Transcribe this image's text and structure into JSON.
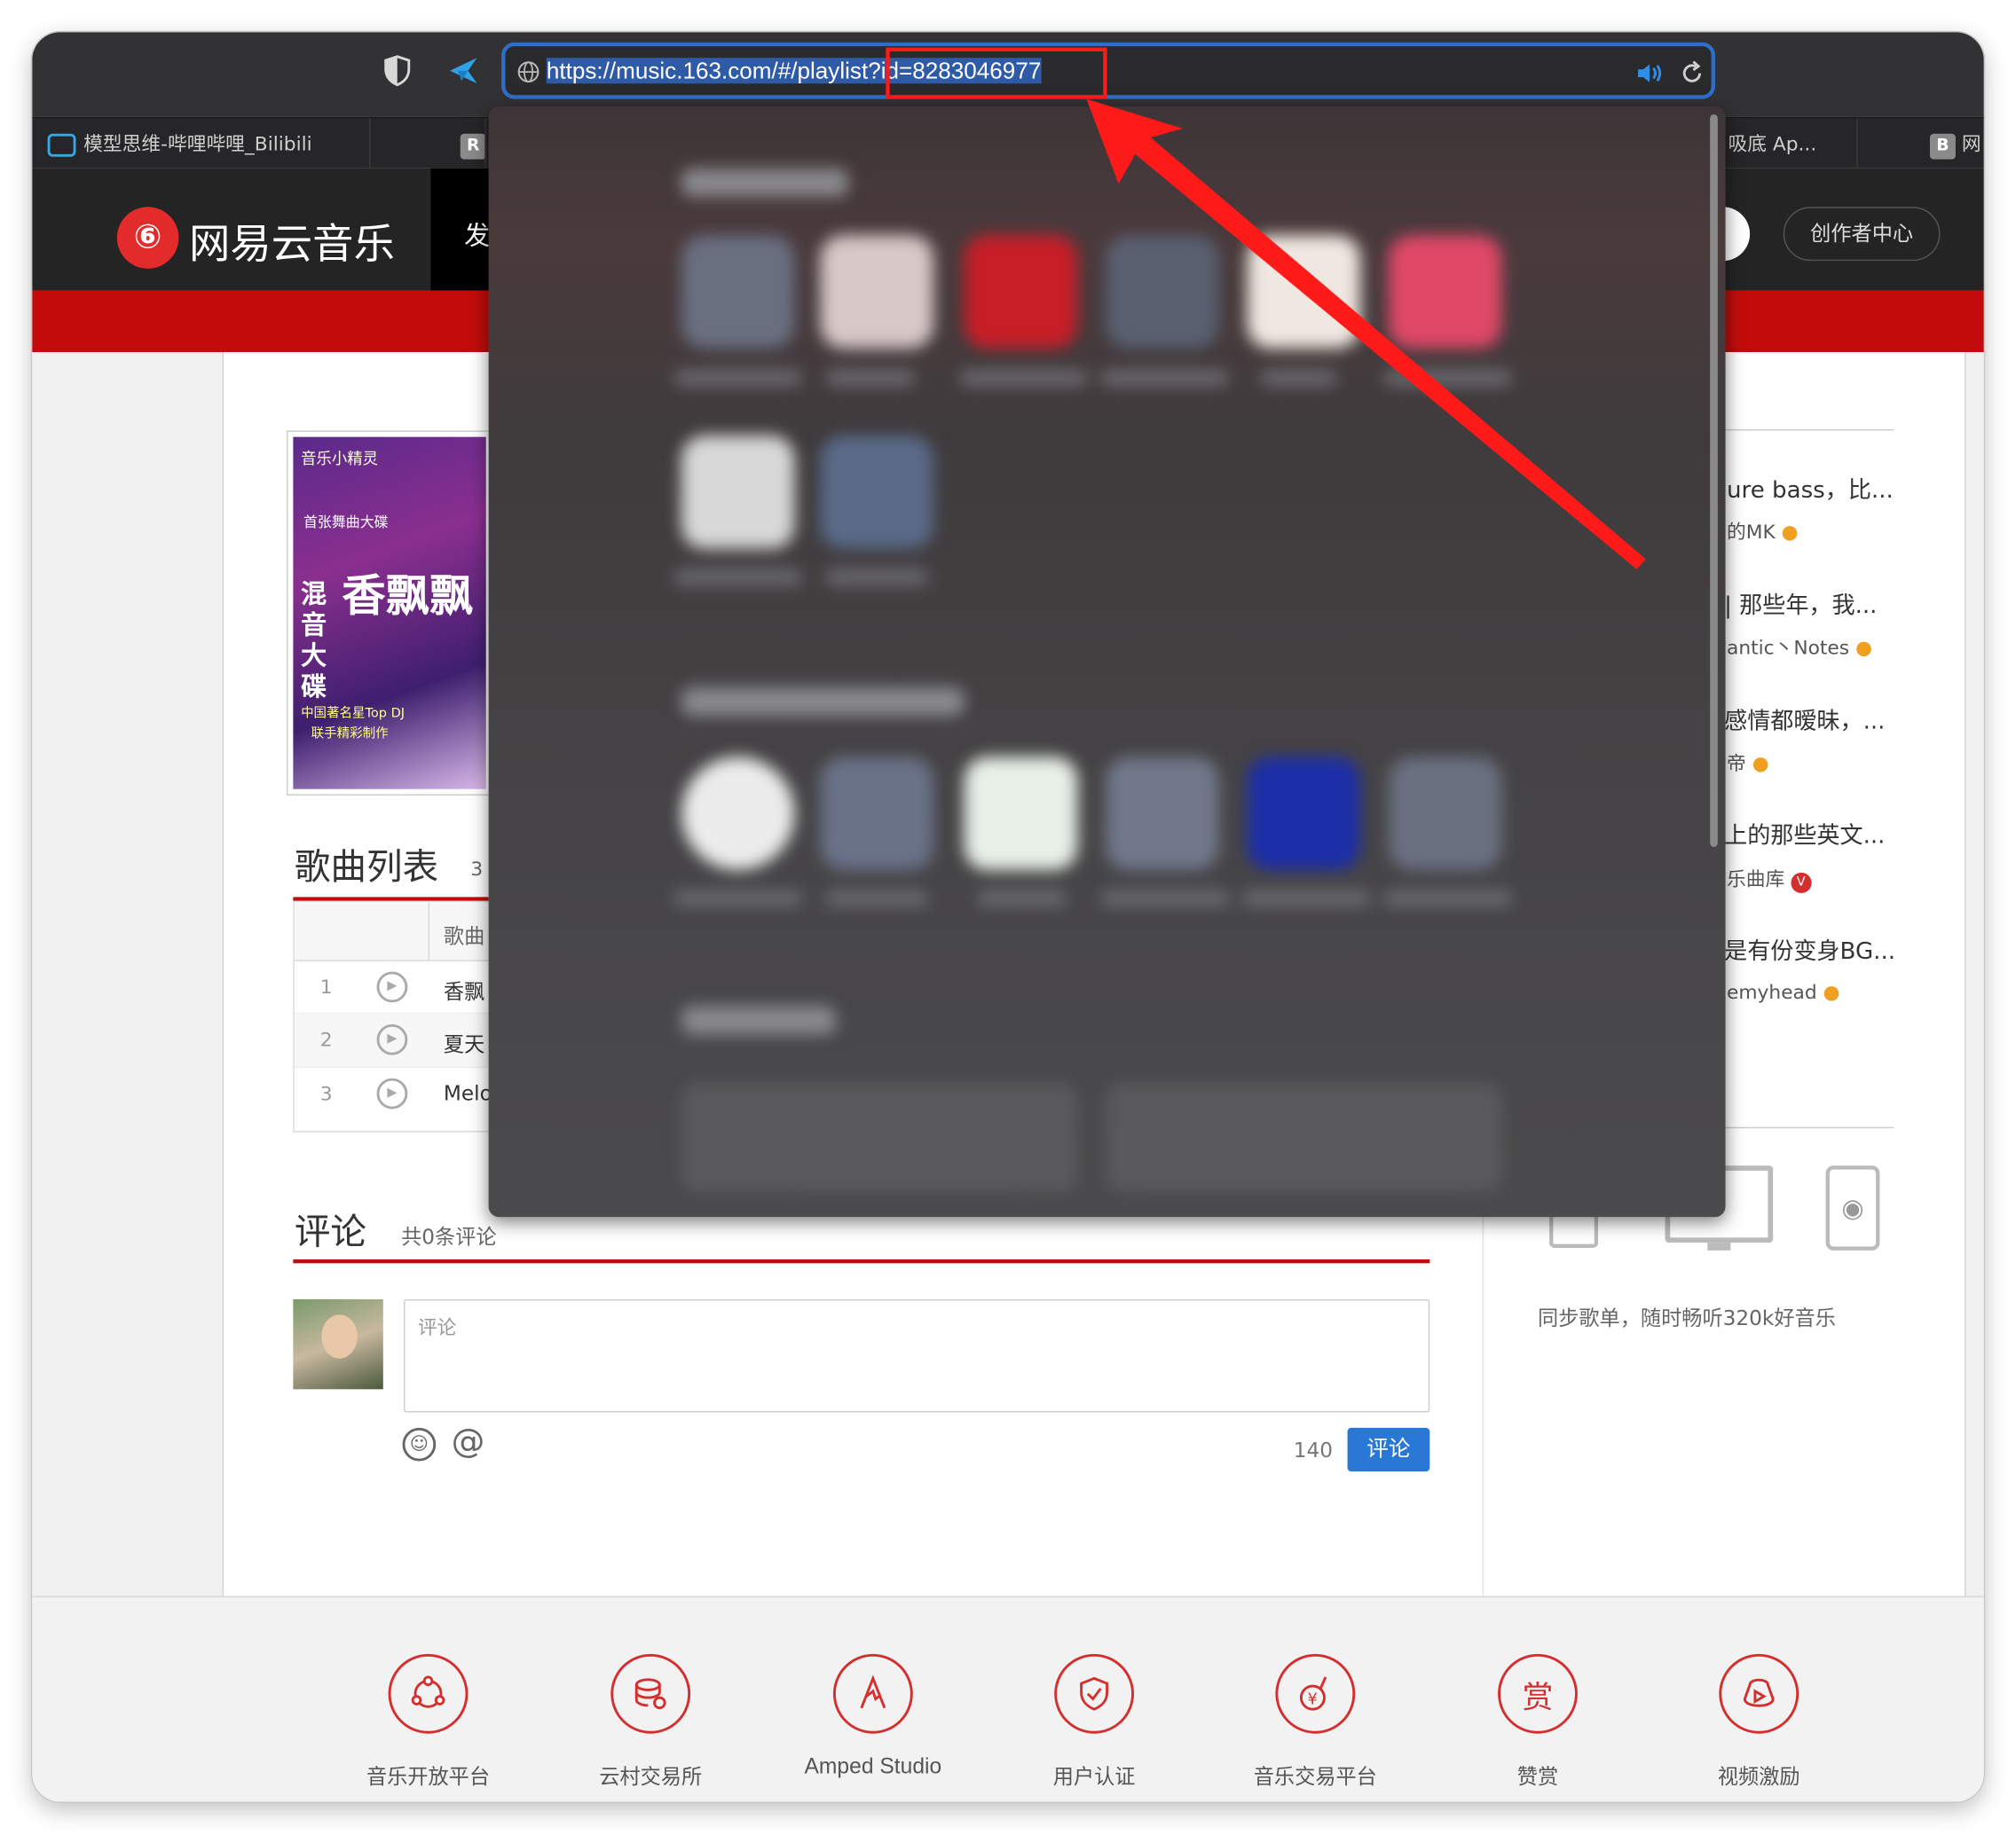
{
  "browser": {
    "url_prefix": "https://music.163.com/#/playlist",
    "url_highlighted": "?id=8283046977",
    "tabs": [
      {
        "label": "模型思维-哔哩哔哩_Bilibili"
      },
      {
        "label": "R"
      },
      {
        "label": "吸底 Ap..."
      },
      {
        "label": "B"
      },
      {
        "label": "网"
      }
    ]
  },
  "site": {
    "logo": "网易云音乐",
    "nav_first": "发",
    "creator_center": "创作者中心"
  },
  "playlist": {
    "cover_texts": [
      "音乐小精灵",
      "首张舞曲大碟",
      "混音大碟",
      "香飘飘",
      "中国著名星Top DJ",
      "联手精彩制作"
    ],
    "song_list_title": "歌曲列表",
    "song_count_partial": "3",
    "col_song": "歌曲",
    "songs": [
      {
        "index": "1",
        "name": "香飘"
      },
      {
        "index": "2",
        "name": "夏天"
      },
      {
        "index": "3",
        "name": "Melo"
      }
    ]
  },
  "comments": {
    "title": "评论",
    "count_text": "共0条评论",
    "placeholder": "评论",
    "char_limit": "140",
    "submit": "评论"
  },
  "sidebar": {
    "items": [
      {
        "title": "ure bass，比...",
        "author": "的MK"
      },
      {
        "title": "| 那些年，我...",
        "author": "antic丶Notes"
      },
      {
        "title": "感情都暧昧，...",
        "author": "帝"
      },
      {
        "title": "上的那些英文...",
        "author": "乐曲库"
      },
      {
        "title": "是有份变身BG...",
        "author": "emyhead"
      }
    ],
    "download_tagline": "同步歌单，随时畅听320k好音乐"
  },
  "footer": {
    "items": [
      {
        "label": "音乐开放平台",
        "icon": "music-open-platform-icon"
      },
      {
        "label": "云村交易所",
        "icon": "cloud-village-exchange-icon"
      },
      {
        "label": "Amped Studio",
        "icon": "amped-studio-icon"
      },
      {
        "label": "用户认证",
        "icon": "user-verification-icon"
      },
      {
        "label": "音乐交易平台",
        "icon": "music-trading-icon"
      },
      {
        "label": "赞赏",
        "icon": "reward-icon",
        "glyph": "赏"
      },
      {
        "label": "视频激励",
        "icon": "video-incentive-icon"
      }
    ]
  },
  "annotation": {
    "color": "#ff0000"
  }
}
